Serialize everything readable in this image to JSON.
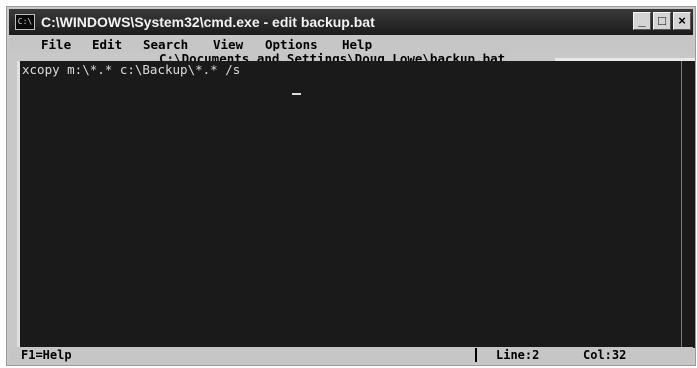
{
  "window": {
    "icon_text": "C:\\",
    "title": "C:\\WINDOWS\\System32\\cmd.exe - edit backup.bat",
    "buttons": {
      "minimize": "_",
      "maximize": "□",
      "close": "×"
    }
  },
  "menu": {
    "items": [
      "File",
      "Edit",
      "Search",
      "View",
      "Options",
      "Help"
    ]
  },
  "editor": {
    "file_path": "C:\\Documents and Settings\\Doug Lowe\\backup.bat",
    "lines": [
      "xcopy m:\\*.* c:\\Backup\\*.* /s"
    ]
  },
  "status": {
    "help": "F1=Help",
    "line": "Line:2",
    "col": "Col:32"
  }
}
